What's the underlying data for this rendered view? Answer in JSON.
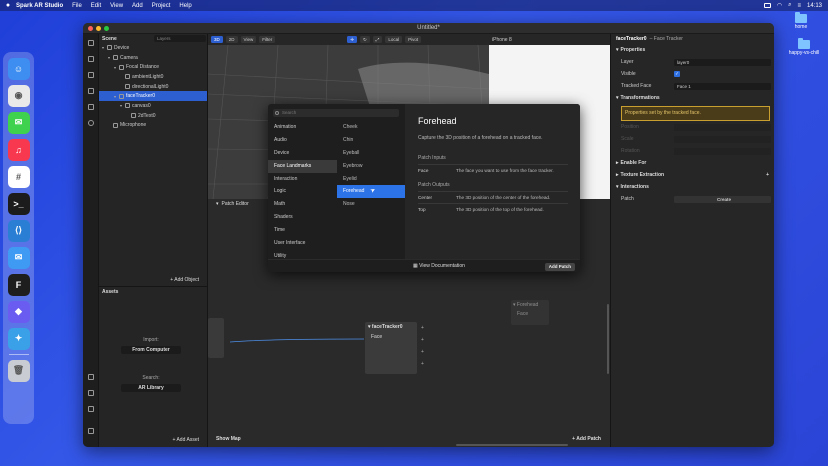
{
  "menubar": {
    "app_name": "Spark AR Studio",
    "items": [
      "File",
      "Edit",
      "View",
      "Add",
      "Project",
      "Help"
    ],
    "clock": "14:13"
  },
  "desktop": {
    "icons": [
      {
        "label": "home"
      },
      {
        "label": "happy-vs-chill"
      }
    ]
  },
  "dock": {
    "apps": [
      {
        "name": "finder",
        "color": "#3d8ef0",
        "glyph": "☺"
      },
      {
        "name": "chrome",
        "color": "#e9e9e9",
        "glyph": "◉"
      },
      {
        "name": "messages",
        "color": "#3fd24e",
        "glyph": "✉"
      },
      {
        "name": "music",
        "color": "#f8384f",
        "glyph": "♫"
      },
      {
        "name": "slack",
        "color": "#ffffff",
        "glyph": "#"
      },
      {
        "name": "terminal",
        "color": "#1c1c1c",
        "glyph": ">_"
      },
      {
        "name": "vscode",
        "color": "#2a7fd4",
        "glyph": "⟨⟩"
      },
      {
        "name": "mail",
        "color": "#3e9af2",
        "glyph": "✉"
      },
      {
        "name": "figma",
        "color": "#1e1e1e",
        "glyph": "F"
      },
      {
        "name": "spark-ar",
        "color": "#6a5cf0",
        "glyph": "◆"
      },
      {
        "name": "tweetbot",
        "color": "#3aa0e8",
        "glyph": "✦"
      },
      {
        "name": "trash",
        "color": "#c9ccd2",
        "glyph": "🗑"
      }
    ]
  },
  "window": {
    "title": "Untitled*"
  },
  "scene": {
    "title": "Scene",
    "layers_tab": "Layers",
    "tree": [
      {
        "label": "Device",
        "indent": 0,
        "selected": false
      },
      {
        "label": "Camera",
        "indent": 1,
        "selected": false
      },
      {
        "label": "Focal Distance",
        "indent": 2,
        "selected": false
      },
      {
        "label": "ambientLight0",
        "indent": 3,
        "selected": false
      },
      {
        "label": "directionalLight0",
        "indent": 3,
        "selected": false
      },
      {
        "label": "faceTracker0",
        "indent": 2,
        "selected": true
      },
      {
        "label": "canvas0",
        "indent": 3,
        "selected": false
      },
      {
        "label": "2dText0",
        "indent": 4,
        "selected": false
      },
      {
        "label": "Microphone",
        "indent": 1,
        "selected": false
      }
    ],
    "add_object": "+ Add Object"
  },
  "assets": {
    "title": "Assets",
    "import_label": "Import:",
    "from_computer": "From Computer",
    "search_label": "Search:",
    "ar_library": "AR Library",
    "add_asset": "+ Add Asset"
  },
  "viewport": {
    "mode_3d": "3D",
    "mode_2d": "2D",
    "view": "View",
    "filter": "Filter",
    "local": "Local",
    "pivot": "Pivot",
    "device": "iPhone 8"
  },
  "patch_editor": {
    "title": "Patch Editor",
    "show_map": "Show Map",
    "add_patch": "+ Add Patch",
    "node_title": "faceTracker0",
    "node_port": "Face",
    "ghost_node_title": "Forehead",
    "ghost_node_port": "Face"
  },
  "popup": {
    "search_placeholder": "Search",
    "categories": [
      "Animation",
      "Audio",
      "Device",
      "Face Landmarks",
      "Interaction",
      "Logic",
      "Math",
      "Shaders",
      "Time",
      "User Interface",
      "Utility"
    ],
    "selected_category": "Face Landmarks",
    "items": [
      "Cheek",
      "Chin",
      "Eyeball",
      "Eyebrow",
      "Eyelid",
      "Forehead",
      "Nose"
    ],
    "selected_item": "Forehead",
    "detail_title": "Forehead",
    "detail_desc": "Capture the 3D position of a forehead on a tracked face.",
    "inputs_title": "Patch Inputs",
    "inputs": [
      {
        "name": "Face",
        "desc": "The face you want to use from the face tracker."
      }
    ],
    "outputs_title": "Patch Outputs",
    "outputs": [
      {
        "name": "Center",
        "desc": "The 3D position of the center of the forehead."
      },
      {
        "name": "Top",
        "desc": "The 3D position of the top of the forehead."
      }
    ],
    "view_doc": "View Documentation",
    "add_patch": "Add Patch"
  },
  "inspector": {
    "object_name": "faceTracker0",
    "object_type": "– Face Tracker",
    "properties_title": "Properties",
    "layer_label": "Layer",
    "layer_value": "layer0",
    "visible_label": "Visible",
    "tracked_face_label": "Tracked Face",
    "tracked_face_value": "Face 1",
    "transformations_title": "Transformations",
    "transform_note": "Properties set by the tracked face.",
    "position_label": "Position",
    "scale_label": "Scale",
    "rotation_label": "Rotation",
    "enable_for": "Enable For",
    "texture_extraction": "Texture Extraction",
    "interactions": "Interactions",
    "patch_label": "Patch",
    "create_label": "Create"
  }
}
